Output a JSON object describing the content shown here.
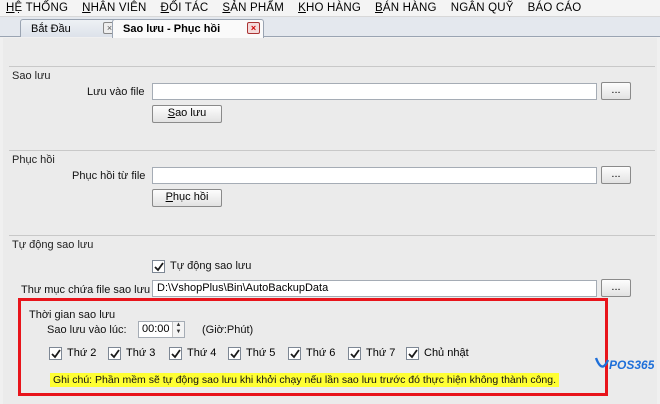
{
  "menu": {
    "items": [
      {
        "hot": "H",
        "rest": "Ệ THỐNG"
      },
      {
        "hot": "N",
        "rest": "HÂN VIÊN"
      },
      {
        "hot": "Đ",
        "rest": "ỐI TÁC"
      },
      {
        "hot": "S",
        "rest": "ẢN PHẨM"
      },
      {
        "hot": "K",
        "rest": "HO HÀNG"
      },
      {
        "hot": "B",
        "rest": "ÁN HÀNG"
      },
      {
        "hot": "",
        "rest": "NGÂN QUỸ"
      },
      {
        "hot": "",
        "rest": "BÁO CÁO"
      }
    ]
  },
  "tabs": [
    {
      "label": "Bắt Đầu",
      "close": "×",
      "active": false
    },
    {
      "label": "Sao lưu - Phục hồi",
      "close": "×",
      "active": true
    }
  ],
  "backup": {
    "title": "Sao lưu",
    "file_label": "Lưu vào file",
    "file_value": "",
    "browse": "...",
    "button": "Sao lưu"
  },
  "restore": {
    "title": "Phục hồi",
    "file_label": "Phục hồi từ file",
    "file_value": "",
    "browse": "...",
    "button": "Phục hồi"
  },
  "auto": {
    "title": "Tự động sao lưu",
    "enable_label": "Tự động sao lưu",
    "enable_checked": true,
    "folder_label": "Thư mục chứa file sao lưu",
    "folder_value": "D:\\VshopPlus\\Bin\\AutoBackupData",
    "browse": "..."
  },
  "schedule": {
    "title": "Thời gian sao lưu",
    "time_label": "Sao lưu vào lúc:",
    "time_value": "00:00",
    "time_unit": "(Giờ:Phút)",
    "days": [
      {
        "label": "Thứ 2",
        "checked": true
      },
      {
        "label": "Thứ 3",
        "checked": true
      },
      {
        "label": "Thứ 4",
        "checked": true
      },
      {
        "label": "Thứ 5",
        "checked": true
      },
      {
        "label": "Thứ 6",
        "checked": true
      },
      {
        "label": "Thứ 7",
        "checked": true
      },
      {
        "label": "Chủ nhật",
        "checked": true
      }
    ],
    "note": "Ghi chú: Phần mềm sẽ tự động sao lưu khi khởi chạy nếu lần sao lưu trước đó thực hiện không thành công."
  },
  "logo": {
    "text": "POS365",
    "color": "#1e6fd9"
  },
  "colors": {
    "highlight_border": "#e8141b",
    "note_bg": "#ffff33"
  }
}
